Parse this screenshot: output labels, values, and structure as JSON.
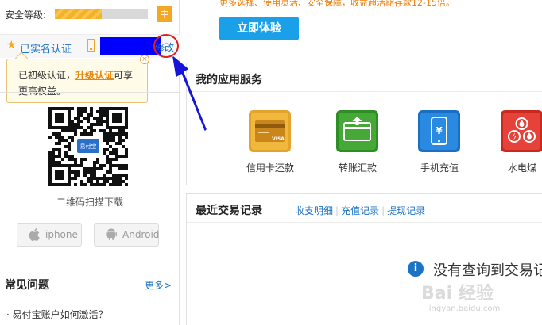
{
  "account": {
    "security_label": "安全等级:",
    "security_level": "中",
    "security_progress": 0.5,
    "verified_label": "已实名认证",
    "modify_label": "修改"
  },
  "tooltip": {
    "text_prefix": "已初级认证，",
    "link_label": "升级认证",
    "text_suffix": "可享",
    "line2": "更高权益。",
    "close": "×"
  },
  "download": {
    "qr_label": "二维码扫描下载",
    "qr_logo_text": "易付宝",
    "ios_label": "iphone",
    "android_label": "Android"
  },
  "faq": {
    "title": "常见问题",
    "more_label": "更多>",
    "first_item": "· 易付宝账户如何激活？"
  },
  "promo": {
    "text": "更多选择、使用灵活、安全保障，收益超活期存款12-15倍。",
    "cta_label": "立即体验"
  },
  "apps": {
    "title": "我的应用服务",
    "items": [
      {
        "label": "信用卡还款",
        "icon": "credit-card-icon",
        "color": "#e6a92c"
      },
      {
        "label": "转账汇款",
        "icon": "transfer-icon",
        "color": "#3a9a2c"
      },
      {
        "label": "手机充值",
        "icon": "mobile-recharge-icon",
        "color": "#1f7ed6"
      },
      {
        "label": "水电煤",
        "icon": "utilities-icon",
        "color": "#e03b2f"
      }
    ]
  },
  "transactions": {
    "title": "最近交易记录",
    "links": [
      "收支明细",
      "充值记录",
      "提现记录"
    ],
    "empty_message": "没有查询到交易记"
  },
  "watermark": {
    "brand": "Bai 经验",
    "url": "jingyan.baidu.com"
  },
  "colors": {
    "link": "#1a73c4",
    "accent": "#f5a623",
    "cta": "#1aa0e8",
    "annotation": "#e02020",
    "annotation_arrow": "#1515d8"
  }
}
